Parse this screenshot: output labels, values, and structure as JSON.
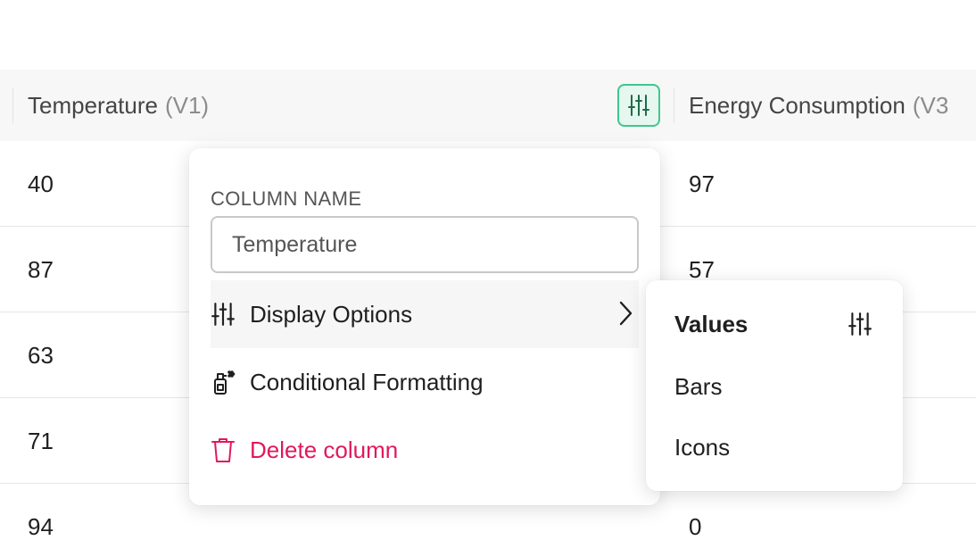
{
  "table": {
    "columns": [
      {
        "name": "Temperature",
        "tag": "(V1)"
      },
      {
        "name": "Energy Consumption",
        "tag": "(V3"
      }
    ],
    "rows": [
      {
        "a": "40",
        "b": "97"
      },
      {
        "a": "87",
        "b": "57"
      },
      {
        "a": "63",
        "b": ""
      },
      {
        "a": "71",
        "b": ""
      },
      {
        "a": "94",
        "b": "0"
      }
    ]
  },
  "menu": {
    "column_name_label": "COLUMN NAME",
    "column_name_value": "Temperature",
    "items": {
      "display_options": "Display Options",
      "conditional_formatting": "Conditional Formatting",
      "delete_column": "Delete column"
    }
  },
  "submenu": {
    "items": [
      "Values",
      "Bars",
      "Icons"
    ],
    "selected": "Values"
  },
  "colors": {
    "accent": "#3fc78f",
    "accent_bg": "#e5f7ee",
    "danger": "#e0195a"
  }
}
